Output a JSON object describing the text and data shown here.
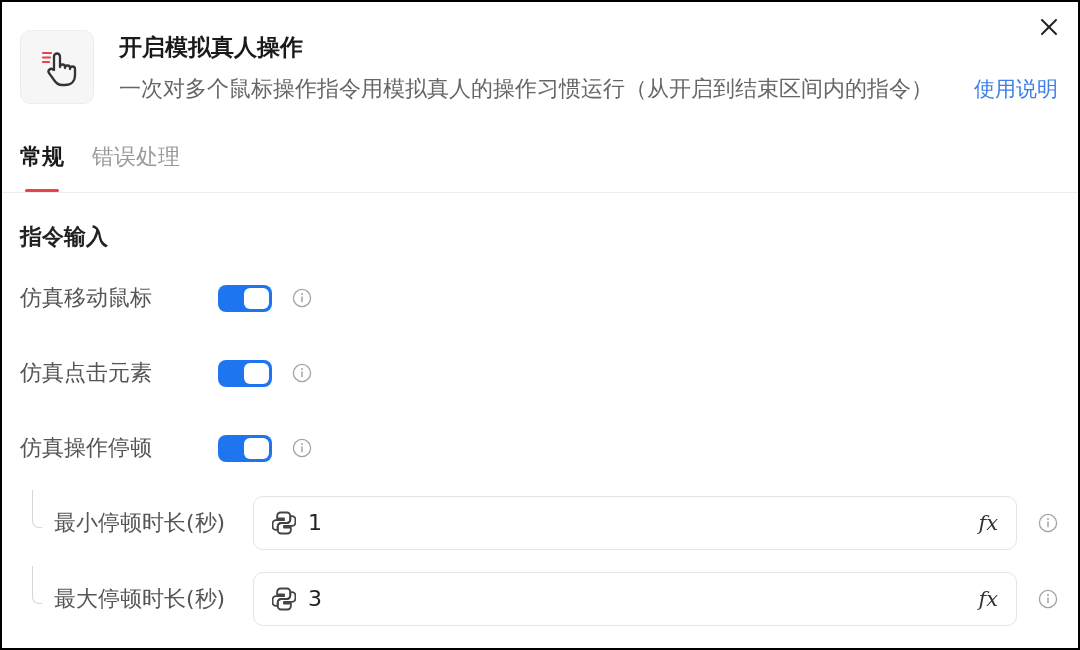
{
  "dialog": {
    "title": "开启模拟真人操作",
    "description": "一次对多个鼠标操作指令用模拟真人的操作习惯运行（从开启到结束区间内的指令）",
    "help_link": "使用说明"
  },
  "tabs": [
    {
      "label": "常规",
      "selected": true
    },
    {
      "label": "错误处理",
      "selected": false
    }
  ],
  "section": {
    "title": "指令输入"
  },
  "options": [
    {
      "kind": "toggle",
      "label": "仿真移动鼠标",
      "on": true
    },
    {
      "kind": "toggle",
      "label": "仿真点击元素",
      "on": true
    },
    {
      "kind": "toggle",
      "label": "仿真操作停顿",
      "on": true,
      "children": [
        {
          "kind": "input",
          "label": "最小停顿时长(秒)",
          "value": "1",
          "formula_button": "fx"
        },
        {
          "kind": "input",
          "label": "最大停顿时长(秒)",
          "value": "3",
          "formula_button": "fx"
        }
      ]
    }
  ]
}
